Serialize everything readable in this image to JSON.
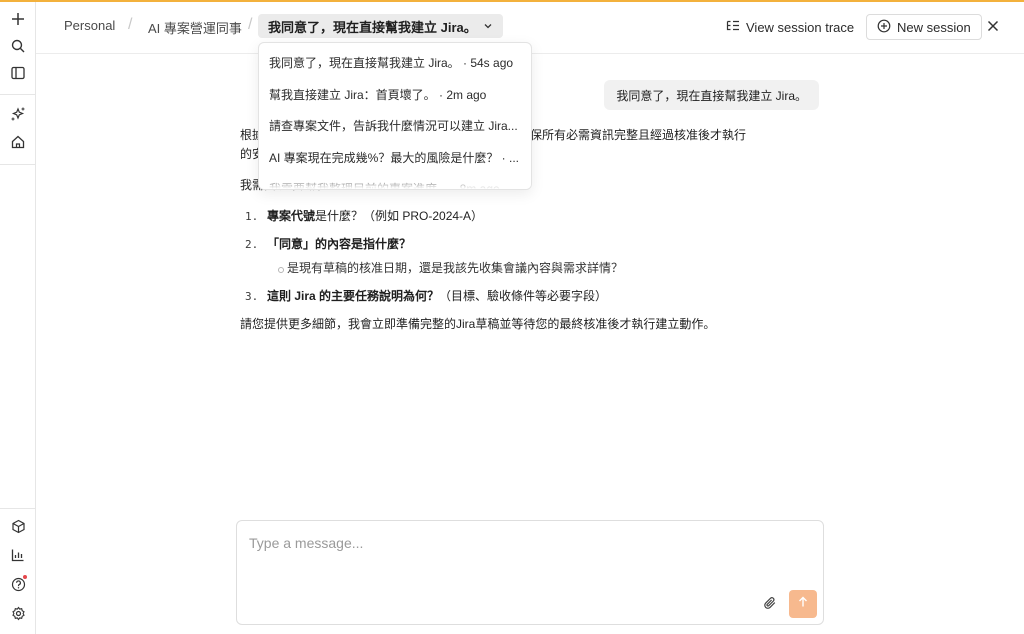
{
  "colors": {
    "accent_bar": "#f3b13c",
    "send_button": "#f7b98e",
    "notification_dot": "#e5484d"
  },
  "sidebar": {
    "top_icons": [
      "plus-icon",
      "search-icon",
      "panel-icon",
      "sparkles-icon",
      "home-icon"
    ],
    "bottom_icons": [
      "box-icon",
      "chart-icon",
      "help-icon",
      "settings-icon"
    ]
  },
  "breadcrumb": {
    "items": [
      "Personal",
      "AI 專案營運同事"
    ],
    "separator": "/",
    "current": "我同意了，現在直接幫我建立 Jira。"
  },
  "header": {
    "trace_label": "View session trace",
    "new_session_label": "New session"
  },
  "session_dropdown": {
    "items": [
      "我同意了，現在直接幫我建立 Jira。 · 54s ago",
      "幫我直接建立 Jira：首頁壞了。 · 2m ago",
      "請查專案文件，告訴我什麼情況可以建立 Jira...",
      "AI 專案現在完成幾%？最大的風險是什麼？ · ...",
      "我需要幫我整理目前的專案進度。 · 8m ago"
    ]
  },
  "chat": {
    "user_message": "我同意了，現在直接幫我建立 Jira。",
    "answer_intro_line1": "根據您的需求，建立 Jira 會直接寫入外部系統，需要確保所有必需資訊完整且經過核准後才執行",
    "answer_intro_line2": "的安全操作。",
    "need_text": "我需要以下資訊：",
    "list": [
      {
        "num": "1.",
        "bold": "專案代號",
        "rest": "是什麼？（例如 PRO-2024-A）"
      },
      {
        "num": "2.",
        "bold": "「同意」的內容是指什麼？",
        "rest": "",
        "sub": "是現有草稿的核准日期，還是我該先收集會議內容與需求詳情？"
      },
      {
        "num": "3.",
        "bold": "這則 Jira 的主要任務說明為何？",
        "rest": "（目標、驗收條件等必要字段）"
      }
    ],
    "closing": "請您提供更多細節，我會立即準備完整的Jira草稿並等待您的最終核准後才執行建立動作。"
  },
  "composer": {
    "placeholder": "Type a message..."
  }
}
